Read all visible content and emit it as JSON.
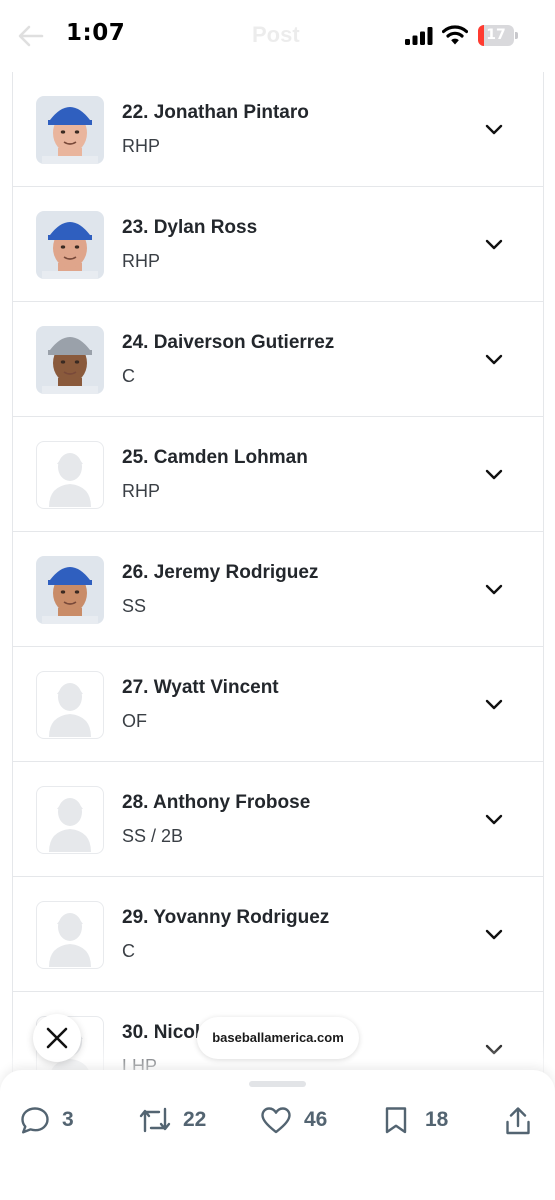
{
  "status_bar": {
    "time": "1:07",
    "header_title": "Post",
    "battery_level": "17",
    "battery_fraction": 0.17,
    "icons": [
      "back-arrow-icon",
      "signal-icon",
      "wifi-icon",
      "battery-icon"
    ]
  },
  "players": [
    {
      "name": "22. Jonathan Pintaro",
      "position": "RHP",
      "photo": "photo",
      "cap": "#2f5fbf",
      "skin": "#e9b59d"
    },
    {
      "name": "23. Dylan Ross",
      "position": "RHP",
      "photo": "photo",
      "cap": "#2f5fbf",
      "skin": "#dfa58b"
    },
    {
      "name": "24. Daiverson Gutierrez",
      "position": "C",
      "photo": "photo",
      "cap": "#9aa1aa",
      "skin": "#8a5a3c"
    },
    {
      "name": "25. Camden Lohman",
      "position": "RHP",
      "photo": "placeholder"
    },
    {
      "name": "26. Jeremy Rodriguez",
      "position": "SS",
      "photo": "photo",
      "cap": "#2f5fbf",
      "skin": "#c98c68"
    },
    {
      "name": "27. Wyatt Vincent",
      "position": "OF",
      "photo": "placeholder"
    },
    {
      "name": "28. Anthony Frobose",
      "position": "SS / 2B",
      "photo": "placeholder"
    },
    {
      "name": "29. Yovanny Rodriguez",
      "position": "C",
      "photo": "placeholder"
    },
    {
      "name": "30. Nicol",
      "position": "LHP",
      "photo": "placeholder"
    }
  ],
  "link_card": {
    "domain": "baseballamerica.com",
    "close_icon": "close-icon"
  },
  "actions": {
    "replies": "3",
    "reposts": "22",
    "likes": "46",
    "bookmarks": "18",
    "icons": [
      "reply-icon",
      "repost-icon",
      "like-icon",
      "bookmark-icon",
      "share-icon"
    ]
  },
  "colors": {
    "battery_red": "#ff3b30",
    "action_gray": "#536471",
    "divider": "#e5e7ea"
  }
}
